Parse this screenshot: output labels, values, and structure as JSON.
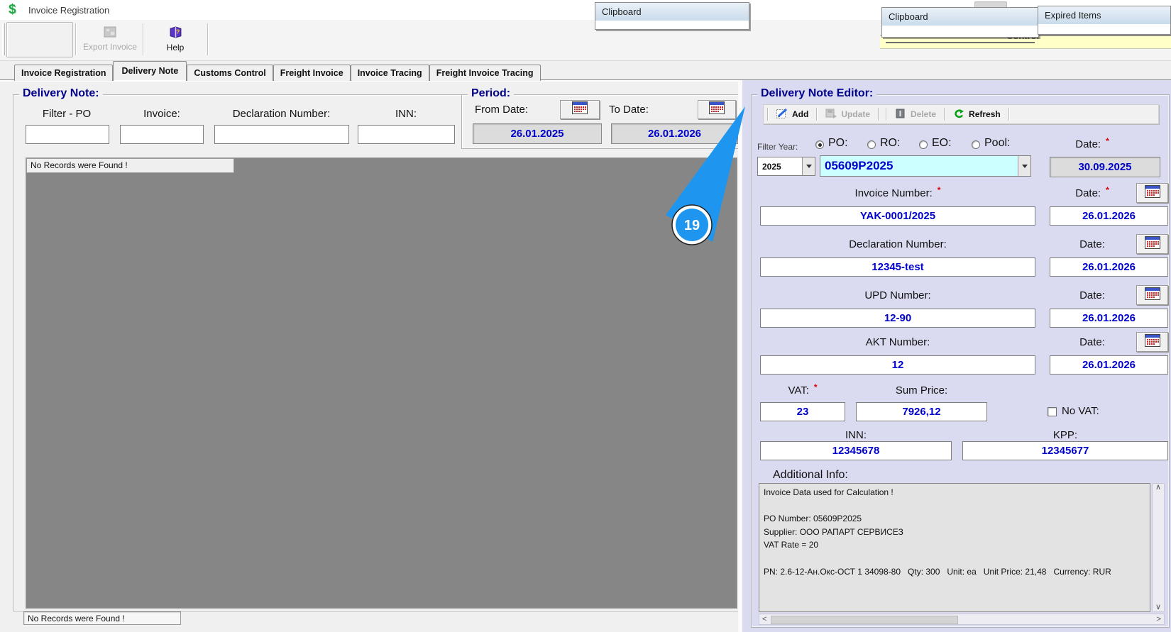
{
  "window": {
    "title": "Invoice Registration"
  },
  "toolbar": {
    "export_invoice": "Export Invoice",
    "help": "Help"
  },
  "popups": {
    "clipboard_a": "Clipboard",
    "clipboard_b": "Clipboard",
    "expired_items": "Expired Items",
    "banner_visible_text": "Control"
  },
  "tabs": [
    {
      "label": "Invoice Registration"
    },
    {
      "label": "Delivery Note"
    },
    {
      "label": "Customs Control"
    },
    {
      "label": "Freight Invoice"
    },
    {
      "label": "Invoice Tracing"
    },
    {
      "label": "Freight Invoice Tracing"
    }
  ],
  "required_marker": "*",
  "delivery_note": {
    "title": "Delivery Note:",
    "filters": [
      {
        "label": "Filter - PO",
        "value": ""
      },
      {
        "label": "Invoice:",
        "value": ""
      },
      {
        "label": "Declaration Number:",
        "value": ""
      },
      {
        "label": "INN:",
        "value": ""
      }
    ],
    "grid_message": "No Records were Found !",
    "status_message": "No Records were Found !"
  },
  "period": {
    "title": "Period:",
    "from_label": "From Date:",
    "from_value": "26.01.2025",
    "to_label": "To Date:",
    "to_value": "26.01.2026"
  },
  "editor": {
    "title": "Delivery Note Editor:",
    "toolbar": {
      "add": "Add",
      "update": "Update",
      "delete": "Delete",
      "refresh": "Refresh"
    },
    "filter_year_label": "Filter Year:",
    "year_value": "2025",
    "order_types": [
      {
        "label": "PO:",
        "selected": true
      },
      {
        "label": "RO:",
        "selected": false
      },
      {
        "label": "EO:",
        "selected": false
      },
      {
        "label": "Pool:",
        "selected": false
      }
    ],
    "po_number": "05609P2025",
    "po_date_label": "Date:",
    "po_date_value": "30.09.2025",
    "fields": [
      {
        "label": "Invoice Number:",
        "value": "YAK-0001/2025",
        "date_label": "Date:",
        "date_value": "26.01.2026"
      },
      {
        "label": "Declaration Number:",
        "value": "12345-test",
        "date_label": "Date:",
        "date_value": "26.01.2026"
      },
      {
        "label": "UPD Number:",
        "value": "12-90",
        "date_label": "Date:",
        "date_value": "26.01.2026"
      },
      {
        "label": "AKT Number:",
        "value": "12",
        "date_label": "Date:",
        "date_value": "26.01.2026"
      }
    ],
    "vat_label": "VAT:",
    "vat_value": "23",
    "sum_price_label": "Sum Price:",
    "sum_price_value": "7926,12",
    "no_vat_label": "No VAT:",
    "inn_label": "INN:",
    "inn_value": "12345678",
    "kpp_label": "KPP:",
    "kpp_value": "12345677",
    "additional_info_label": "Additional Info:",
    "additional_info_text": "Invoice Data used for Calculation !\n\nPO Number: 05609P2025\nSupplier: ООО РАПАРТ СЕРВИСЕЗ\nVAT Rate = 20\n\nPN: 2.6-12-Ан.Окс-ОСТ 1 34098-80   Qty: 300   Unit: ea   Unit Price: 21,48   Currency: RUR"
  },
  "annotation": {
    "badge": "19"
  }
}
